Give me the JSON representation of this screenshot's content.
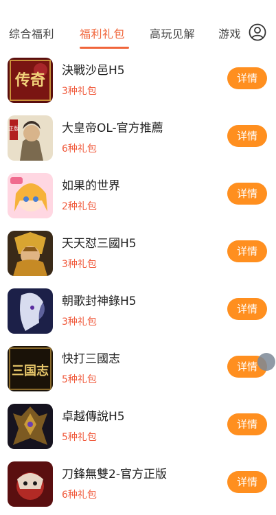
{
  "tabs": [
    {
      "label": "综合福利",
      "active": false
    },
    {
      "label": "福利礼包",
      "active": true
    },
    {
      "label": "高玩见解",
      "active": false
    },
    {
      "label": "游戏",
      "active": false
    }
  ],
  "accent_color": "#f0653a",
  "button_color": "#ff8f1f",
  "user_icon": "user-circle-icon",
  "games": [
    {
      "name": "決戰沙邑H5",
      "gifts": "3种礼包",
      "detail": "详情"
    },
    {
      "name": "大皇帝OL-官方推薦",
      "gifts": "6种礼包",
      "detail": "详情"
    },
    {
      "name": "如果的世界",
      "gifts": "2种礼包",
      "detail": "详情"
    },
    {
      "name": "天天怼三國H5",
      "gifts": "3种礼包",
      "detail": "详情"
    },
    {
      "name": "朝歌封神錄H5",
      "gifts": "3种礼包",
      "detail": "详情"
    },
    {
      "name": "快打三國志",
      "gifts": "5种礼包",
      "detail": "详情"
    },
    {
      "name": "卓越傳說H5",
      "gifts": "5种礼包",
      "detail": "详情"
    },
    {
      "name": "刀鋒無雙2-官方正版",
      "gifts": "6种礼包",
      "detail": "详情"
    }
  ],
  "thumbnail_text": {
    "game1": "传奇",
    "game2": "正版",
    "game6": "三国志"
  }
}
